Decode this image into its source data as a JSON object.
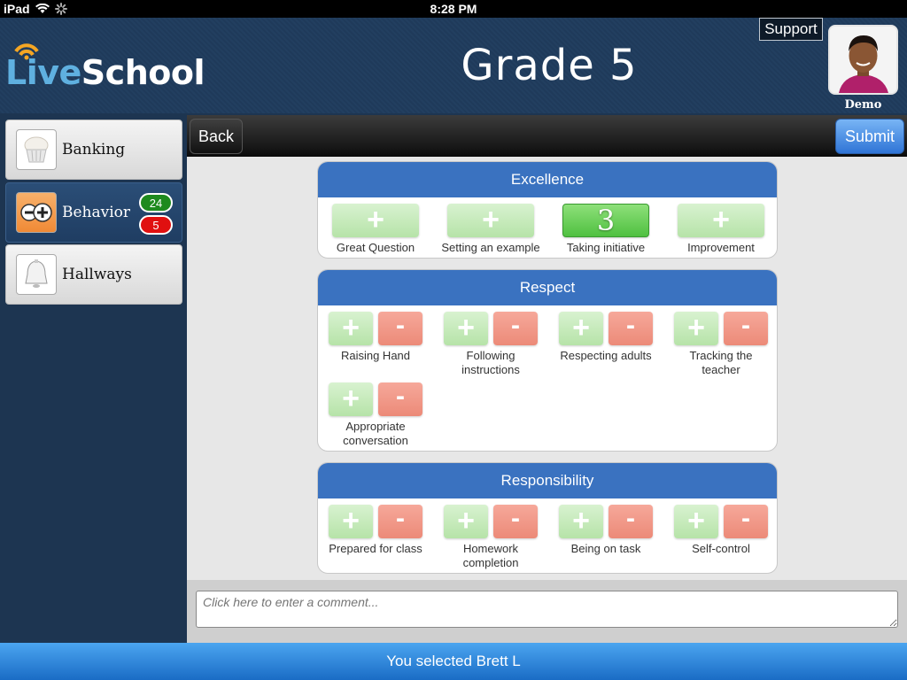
{
  "status_bar": {
    "device": "iPad",
    "time": "8:28 PM"
  },
  "header": {
    "app_name_part1": "Live",
    "app_name_part2": "School",
    "title": "Grade 5",
    "support_label": "Support",
    "user_name": "Demo"
  },
  "sidebar": {
    "items": [
      {
        "label": "Banking",
        "icon": "cupcake-icon"
      },
      {
        "label": "Behavior",
        "icon": "plus-minus-icon",
        "badge_positive": "24",
        "badge_negative": "5"
      },
      {
        "label": "Hallways",
        "icon": "bell-icon"
      }
    ]
  },
  "toolbar": {
    "back_label": "Back",
    "submit_label": "Submit"
  },
  "sections": [
    {
      "title": "Excellence",
      "items": [
        {
          "label": "Great Question"
        },
        {
          "label": "Setting an example"
        },
        {
          "label": "Taking initiative",
          "count": "3"
        },
        {
          "label": "Improvement"
        }
      ]
    },
    {
      "title": "Respect",
      "items": [
        {
          "label": "Raising Hand"
        },
        {
          "label": "Following instructions"
        },
        {
          "label": "Respecting adults"
        },
        {
          "label": "Tracking the teacher"
        },
        {
          "label": "Appropriate conversation"
        }
      ]
    },
    {
      "title": "Responsibility",
      "items": [
        {
          "label": "Prepared for class"
        },
        {
          "label": "Homework completion"
        },
        {
          "label": "Being on task"
        },
        {
          "label": "Self-control"
        }
      ]
    }
  ],
  "buttons": {
    "plus_symbol": "+",
    "minus_symbol": "-"
  },
  "comment": {
    "placeholder": "Click here to enter a comment..."
  },
  "footer": {
    "message": "You selected Brett L"
  },
  "colors": {
    "header_blue": "#3a72c0",
    "positive_green": "#b6e3a8",
    "negative_red": "#ec8a78",
    "footer_blue": "#1a6cc5"
  }
}
